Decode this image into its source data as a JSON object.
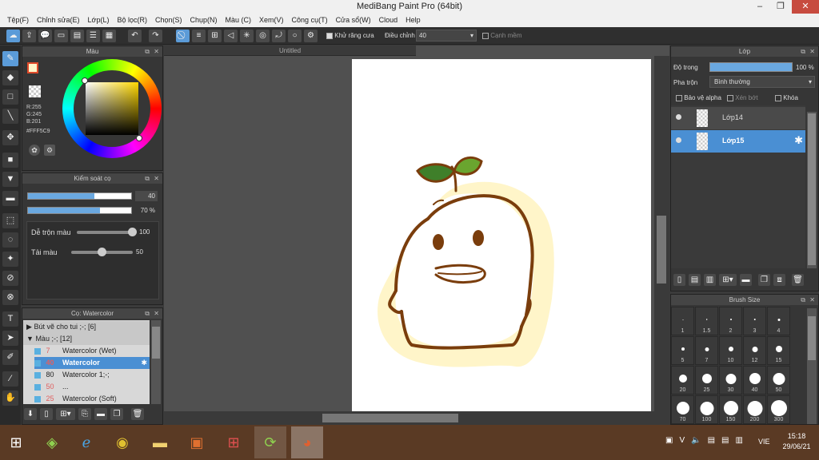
{
  "window": {
    "title": "MediBang Paint Pro (64bit)",
    "min": "–",
    "max": "❐",
    "close": "✕"
  },
  "menu": [
    "Tệp(F)",
    "Chỉnh sửa(E)",
    "Lớp(L)",
    "Bộ lọc(R)",
    "Chọn(S)",
    "Chụp(N)",
    "Màu (C)",
    "Xem(V)",
    "Công cụ(T)",
    "Cửa sổ(W)",
    "Cloud",
    "Help"
  ],
  "toolbar": {
    "antialias_label": "Khử răng cưa",
    "adjust_label": "Điều chỉnh",
    "adjust_value": "40",
    "edge_label": "Cạnh mềm"
  },
  "color_panel": {
    "title": "Màu",
    "r": "R:255",
    "g": "G:245",
    "b": "B:201",
    "hex": "#FFF5C9",
    "fg_color": "#fff5c9"
  },
  "brush_control": {
    "title": "Kiểm soát cọ",
    "size_value": "40",
    "size_fraction": 0.64,
    "opacity_value": "70 %",
    "opacity_fraction": 0.7,
    "blend_label": "Dễ trộn màu",
    "blend_value": "100",
    "blend_fraction": 1.0,
    "amount_label": "Tải màu",
    "amount_value": "50",
    "amount_fraction": 0.5
  },
  "brush_panel": {
    "title": "Cọ: Watercolor",
    "groups": [
      {
        "label": "Bút vẽ cho tui ;-; [6]"
      },
      {
        "label": "Màu ;-; [12]"
      }
    ],
    "items": [
      {
        "size": "7",
        "name": "Watercolor (Wet)"
      },
      {
        "size": "40",
        "name": "Watercolor"
      },
      {
        "size": "80",
        "name": "Watercolor 1;-;"
      },
      {
        "size": "50",
        "name": "..."
      },
      {
        "size": "25",
        "name": "Watercolor (Soft)"
      }
    ]
  },
  "document": {
    "tab": "Untitled"
  },
  "layer_panel": {
    "title": "Lớp",
    "opacity_label": "Độ trong",
    "opacity_value": "100 %",
    "opacity_fraction": 1.0,
    "blend_label": "Pha trộn",
    "blend_value": "Bình thường",
    "protect_alpha": "Bảo vệ alpha",
    "clipping": "Xén bớt",
    "lock": "Khóa",
    "layers": [
      {
        "name": "Lớp14"
      },
      {
        "name": "Lớp15"
      }
    ]
  },
  "brush_size": {
    "title": "Brush Size",
    "sizes": [
      "1",
      "1.5",
      "2",
      "3",
      "4",
      "5",
      "7",
      "10",
      "12",
      "15",
      "20",
      "25",
      "30",
      "40",
      "50",
      "70",
      "100",
      "150",
      "200",
      "300"
    ]
  },
  "taskbar": {
    "lang": "VIE",
    "time": "15:18",
    "date": "29/06/21"
  },
  "colors": {
    "accent": "#5b9bd8",
    "selected_row": "#4a8fd3",
    "brown": "#7a3d0c",
    "cream": "#fff5c9",
    "leaf": "#3f7f2a"
  }
}
